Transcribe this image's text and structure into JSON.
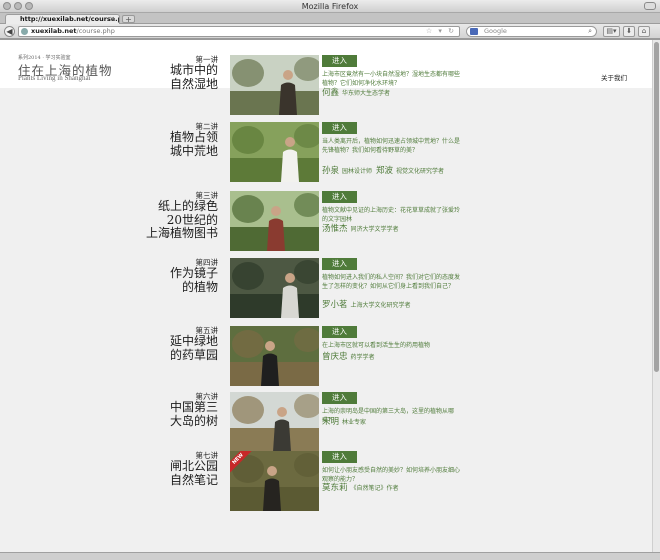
{
  "window": {
    "title": "Mozilla Firefox"
  },
  "tab": {
    "label": "http://xuexilab.net/course.php",
    "close": "×",
    "new": "+"
  },
  "url": {
    "host": "xuexilab.net",
    "path": "/course.php"
  },
  "search": {
    "placeholder": "Google"
  },
  "site": {
    "series": "系列2014 · 学习实验室",
    "title": "住在上海的植物",
    "subtitle": "Plants Living in Shanghai",
    "about": "关于我们"
  },
  "enter_label": "进入",
  "new_badge": "NEW",
  "lectures": [
    {
      "num": "第一讲",
      "title": [
        "城市中的",
        "自然湿地"
      ],
      "desc": "上海市区竟然有一小块自然湿地？湿地生态都有哪些植物？它们如何净化水环境？",
      "speakers": [
        {
          "name": "何鑫",
          "role": "华东师大生态学者"
        }
      ]
    },
    {
      "num": "第二讲",
      "title": [
        "植物占领",
        "城中荒地"
      ],
      "desc": "当人类离开后，植物如何迅速占领城中荒地？什么是先锋植物？我们如何看待野草的美？",
      "speakers": [
        {
          "name": "孙泉",
          "role": "园林设计师"
        },
        {
          "name": "郑波",
          "role": "视觉文化研究学者"
        }
      ]
    },
    {
      "num": "第三讲",
      "title": [
        "纸上的绿色",
        "20世纪的",
        "上海植物图书"
      ],
      "desc": "植物文献中见证的上海历史：花花草草成就了张爱玲的文字园林",
      "speakers": [
        {
          "name": "汤惟杰",
          "role": "同济大学文学学者"
        }
      ]
    },
    {
      "num": "第四讲",
      "title": [
        "作为镜子",
        "的植物"
      ],
      "desc": "植物如何进入我们的私人空间？我们对它们的态度发生了怎样的变化？如何从它们身上看到我们自己？",
      "speakers": [
        {
          "name": "罗小茗",
          "role": "上海大学文化研究学者"
        }
      ]
    },
    {
      "num": "第五讲",
      "title": [
        "延中绿地",
        "的药草园"
      ],
      "desc": "在上海市区就可以看到活生生的药用植物",
      "speakers": [
        {
          "name": "曾庆忠",
          "role": "药学学者"
        }
      ]
    },
    {
      "num": "第六讲",
      "title": [
        "中国第三",
        "大岛的树"
      ],
      "desc": "上海的崇明岛是中国的第三大岛，这里的植物从哪来？",
      "speakers": [
        {
          "name": "宋明",
          "role": "林业专家"
        }
      ]
    },
    {
      "num": "第七讲",
      "title": [
        "闸北公园",
        "自然笔记"
      ],
      "desc": "如何让小朋友感受自然的美妙？如何培养小朋友细心观察的能力？",
      "speakers": [
        {
          "name": "莫东莉",
          "role": "《自然笔记》作者"
        }
      ]
    }
  ]
}
